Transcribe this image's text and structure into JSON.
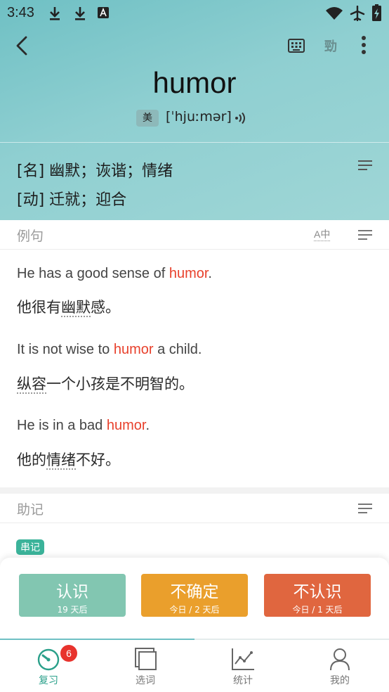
{
  "status_bar": {
    "time": "3:43"
  },
  "word": {
    "headword": "humor",
    "region_badge": "美",
    "phonetic": "[ˈhjuːmər]"
  },
  "definitions": [
    {
      "text": "[名] 幽默；诙谐；情绪"
    },
    {
      "text": "[动] 迁就；迎合"
    }
  ],
  "examples_section": {
    "title": "例句",
    "toggle_label": "A中",
    "items": [
      {
        "en_before": "He has a good sense of ",
        "en_highlight": "humor",
        "en_after": ".",
        "zh_before": "他很有",
        "zh_mark": "幽默",
        "zh_after": "感。"
      },
      {
        "en_before": "It is not wise to ",
        "en_highlight": "humor",
        "en_after": " a child.",
        "zh_before": "",
        "zh_mark": "纵容",
        "zh_after": "一个小孩是不明智的。"
      },
      {
        "en_before": "He is in a bad ",
        "en_highlight": "humor",
        "en_after": ".",
        "zh_before": "他的",
        "zh_mark": "情绪",
        "zh_after": "不好。"
      }
    ]
  },
  "mnemonic_section": {
    "title": "助记",
    "tag": "串记"
  },
  "actions": {
    "know": {
      "label": "认识",
      "sub": "19 天后"
    },
    "unsure": {
      "label": "不确定",
      "sub": "今日 / 2 天后"
    },
    "unknown": {
      "label": "不认识",
      "sub": "今日 / 1 天后"
    }
  },
  "bottom_nav": {
    "review_badge": "6",
    "items": [
      {
        "label": "复习",
        "icon": "review-icon",
        "active": true
      },
      {
        "label": "选词",
        "icon": "wordbook-icon",
        "active": false
      },
      {
        "label": "统计",
        "icon": "stats-icon",
        "active": false
      },
      {
        "label": "我的",
        "icon": "profile-icon",
        "active": false
      }
    ]
  },
  "colors": {
    "header_teal": "#8fcfd1",
    "highlight_red": "#e8412c",
    "know_green": "#82c6b1",
    "unsure_orange": "#ea9f2c",
    "unknown_red": "#e0663f",
    "active_nav": "#2aa08a"
  }
}
